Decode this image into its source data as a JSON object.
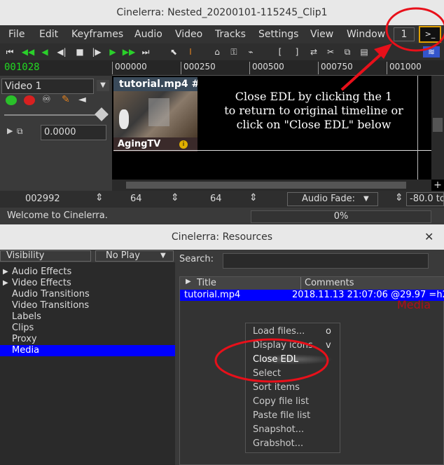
{
  "main_window": {
    "title": "Cinelerra: Nested_20200101-115245_Clip1",
    "menu": [
      "File",
      "Edit",
      "Keyframes",
      "Audio",
      "Video",
      "Tracks",
      "Settings",
      "View",
      "Window"
    ],
    "edl_tab_label": "1",
    "timecode": "001028",
    "ruler_ticks": [
      "000000",
      "000250",
      "000500",
      "000750",
      "001000"
    ],
    "track": {
      "name": "Video 1",
      "fader_value": "0.0000"
    },
    "clip": {
      "title": "tutorial.mp4 #",
      "watermark": "AgingTV"
    },
    "annotation_text": [
      "Close EDL by clicking the 1",
      "to return to original timeline or",
      "click on \"Close EDL\" below"
    ],
    "bottom": {
      "position": "002992",
      "zoom1": "64",
      "zoom2": "64",
      "audio_fade": "Audio Fade:",
      "fade_value": "-80.0 to"
    },
    "status": {
      "message": "Welcome to Cinelerra.",
      "progress": "0%"
    }
  },
  "resources_window": {
    "title": "Cinelerra: Resources",
    "visibility_label": "Visibility",
    "play_mode": "No Play",
    "search_label": "Search:",
    "search_value": "",
    "folders": [
      {
        "label": "Audio Effects",
        "expandable": true
      },
      {
        "label": "Video Effects",
        "expandable": true
      },
      {
        "label": "Audio Transitions",
        "expandable": false
      },
      {
        "label": "Video Transitions",
        "expandable": false
      },
      {
        "label": "Labels",
        "expandable": false
      },
      {
        "label": "Clips",
        "expandable": false
      },
      {
        "label": "Proxy",
        "expandable": false
      },
      {
        "label": "Media",
        "expandable": false,
        "selected": true
      }
    ],
    "columns": [
      "Title",
      "Comments"
    ],
    "rows": [
      {
        "title": "tutorial.mp4",
        "comments": "2018.11.13 21:07:06 @29.97 =h2"
      }
    ],
    "folder_watermark": "Media",
    "context_menu": [
      {
        "label": "Load files...",
        "shortcut": "o"
      },
      {
        "label": "Display icons",
        "shortcut": "v"
      },
      {
        "label": "Close EDL",
        "shortcut": ""
      },
      {
        "label": "Select",
        "shortcut": ""
      },
      {
        "label": "Sort items",
        "shortcut": ""
      },
      {
        "label": "Copy file list",
        "shortcut": ""
      },
      {
        "label": "Paste file list",
        "shortcut": ""
      },
      {
        "label": "Snapshot...",
        "shortcut": ""
      },
      {
        "label": "Grabshot...",
        "shortcut": ""
      }
    ]
  },
  "colors": {
    "accent_blue": "#0000ff",
    "timecode_green": "#22d822",
    "annotation_red": "#e8101a"
  }
}
